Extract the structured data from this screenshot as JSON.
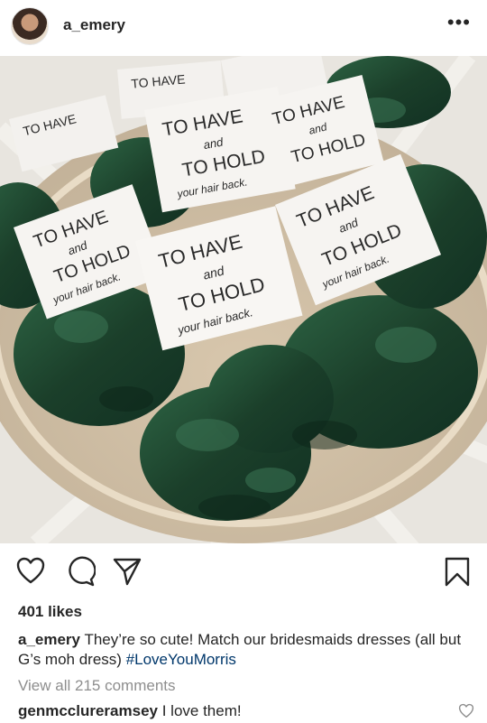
{
  "header": {
    "username": "a_emery",
    "more_label": "•••"
  },
  "post": {
    "image_icon": "photo-scrunchies",
    "tag_text": {
      "line1": "TO HAVE",
      "line2": "and",
      "line3": "TO HOLD",
      "line4": "your hair back."
    },
    "likes_text": "401 likes",
    "caption": {
      "user": "a_emery",
      "text": "They’re so cute! Match our bridesmaids dresses (all but G’s moh dress)",
      "hashtag": "#LoveYouMorris"
    },
    "view_all_comments": "View all 215 comments",
    "comment": {
      "user": "genmcclureramsey",
      "text": "I love them!"
    }
  },
  "icons": {
    "like": "heart-icon",
    "comment": "comment-icon",
    "share": "send-icon",
    "save": "bookmark-icon",
    "comment_like": "heart-icon"
  },
  "colors": {
    "hashtag": "#00376b",
    "muted": "#8e8e8e",
    "velvet": "#1f4a31"
  }
}
